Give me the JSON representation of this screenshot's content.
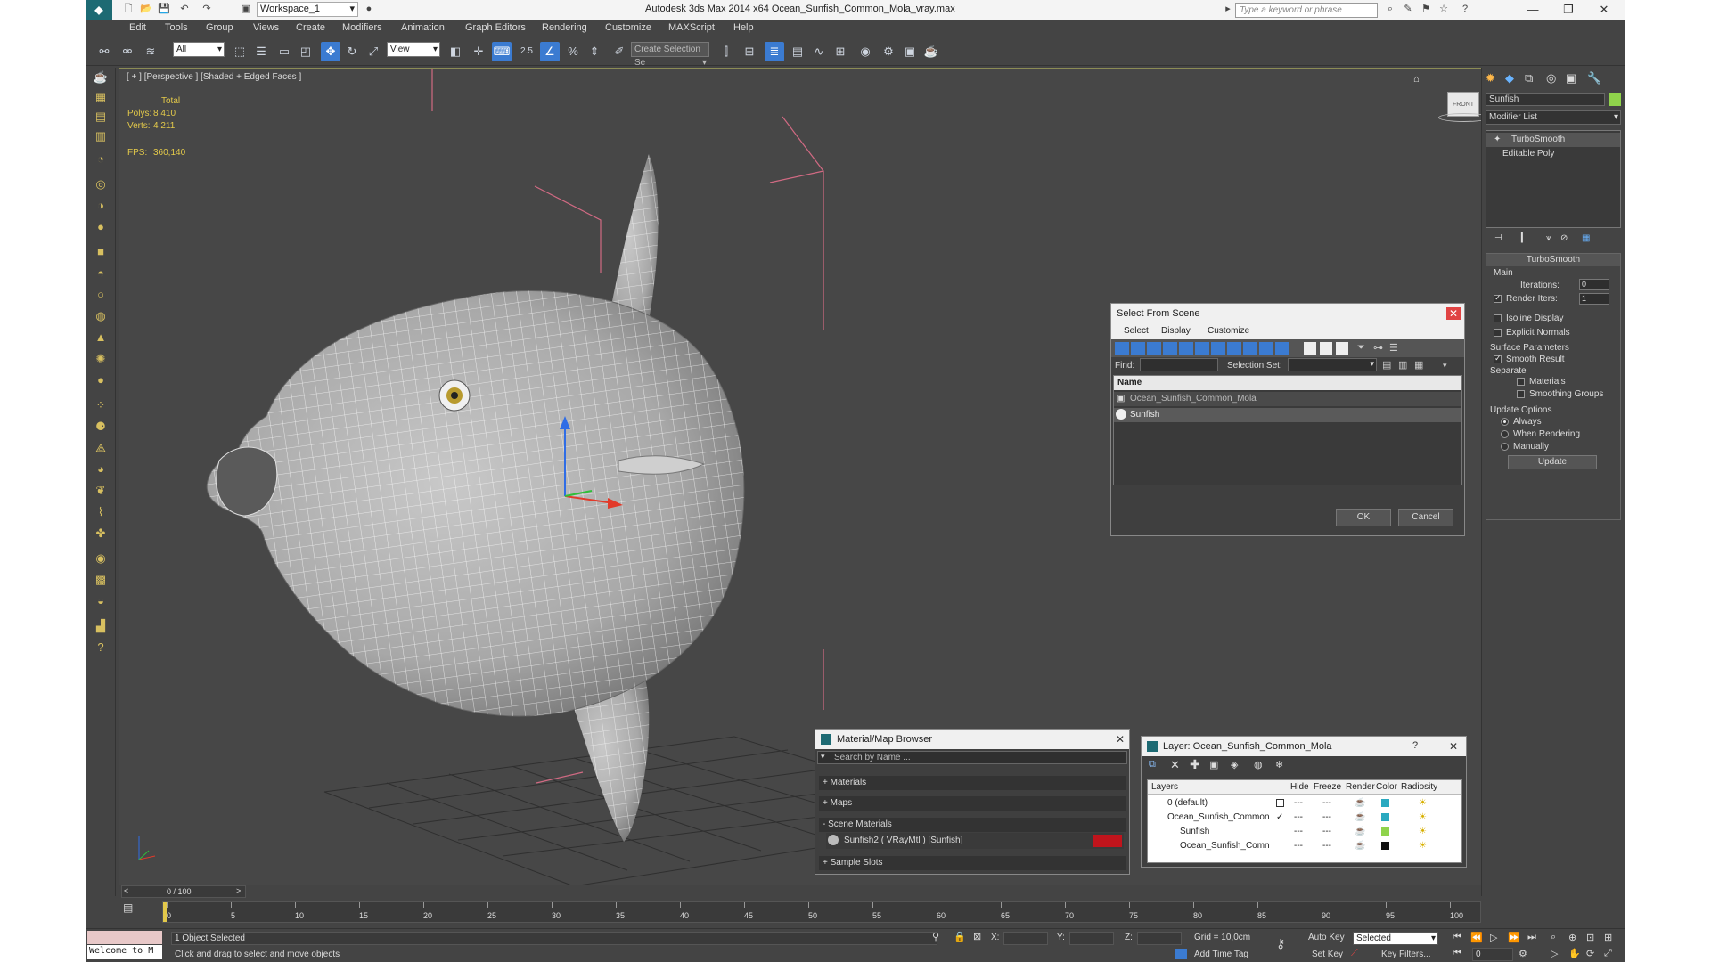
{
  "app": {
    "title": "Autodesk 3ds Max  2014 x64     Ocean_Sunfish_Common_Mola_vray.max",
    "workspace": "Workspace_1",
    "search_placeholder": "Type a keyword or phrase",
    "window_buttons": [
      "—",
      "❐",
      "✕"
    ]
  },
  "menu": [
    "Edit",
    "Tools",
    "Group",
    "Views",
    "Create",
    "Modifiers",
    "Animation",
    "Graph Editors",
    "Rendering",
    "Customize",
    "MAXScript",
    "Help"
  ],
  "toolbar": {
    "filter": "All",
    "refcoord": "View",
    "selection_set_placeholder": "Create Selection Se",
    "snap_label": "2.5"
  },
  "viewport": {
    "label": "[ + ] [Perspective ] [Shaded + Edged Faces ]",
    "stats_header": "Total",
    "polys_label": "Polys:",
    "polys_value": "8 410",
    "verts_label": "Verts:",
    "verts_value": "4 211",
    "fps_label": "FPS:",
    "fps_value": "360,140",
    "viewcube_label": "FRONT"
  },
  "command_panel": {
    "object_name": "Sunfish",
    "object_color": "#8fd34b",
    "modifier_list": "Modifier List",
    "stack": [
      "TurboSmooth",
      "Editable Poly"
    ],
    "rollout_title": "TurboSmooth",
    "main_group": "Main",
    "iterations_label": "Iterations:",
    "iterations_value": "0",
    "render_iters_label": "Render Iters:",
    "render_iters_value": "1",
    "isoline_display": "Isoline Display",
    "explicit_normals": "Explicit Normals",
    "surface_params": "Surface Parameters",
    "smooth_result": "Smooth Result",
    "separate": "Separate",
    "materials": "Materials",
    "smoothing_groups": "Smoothing Groups",
    "update_options": "Update Options",
    "always": "Always",
    "when_rendering": "When Rendering",
    "manually": "Manually",
    "update_button": "Update"
  },
  "select_from_scene": {
    "title": "Select From Scene",
    "menus": [
      "Select",
      "Display",
      "Customize"
    ],
    "find_label": "Find:",
    "selection_set_label": "Selection Set:",
    "column_name": "Name",
    "items": [
      "Ocean_Sunfish_Common_Mola",
      "Sunfish"
    ],
    "ok": "OK",
    "cancel": "Cancel"
  },
  "material_browser": {
    "title": "Material/Map Browser",
    "search_placeholder": "Search by Name ...",
    "groups": [
      "+ Materials",
      "+ Maps",
      "- Scene Materials",
      "+ Sample Slots"
    ],
    "material_item": "Sunfish2  ( VRayMtl )  [Sunfish]",
    "swatch_color": "#c0141c"
  },
  "layer_dialog": {
    "title": "Layer: Ocean_Sunfish_Common_Mola",
    "help": "?",
    "columns": [
      "Layers",
      "Hide",
      "Freeze",
      "Render",
      "Color",
      "Radiosity"
    ],
    "rows": [
      {
        "name": "0 (default)",
        "color": "#2aa9c0"
      },
      {
        "name": "Ocean_Sunfish_Common",
        "color": "#2aa9c0"
      },
      {
        "name": "Sunfish",
        "color": "#8fd34b"
      },
      {
        "name": "Ocean_Sunfish_Comn",
        "color": "#111111"
      }
    ]
  },
  "timeline": {
    "frame": "0 / 100",
    "ticks": [
      "0",
      "5",
      "10",
      "15",
      "20",
      "25",
      "30",
      "35",
      "40",
      "45",
      "50",
      "55",
      "60",
      "65",
      "70",
      "75",
      "80",
      "85",
      "90",
      "95",
      "100"
    ]
  },
  "status": {
    "selected": "1 Object Selected",
    "prompt": "Click and drag to select and move objects",
    "welcome": "Welcome to M",
    "x_label": "X:",
    "y_label": "Y:",
    "z_label": "Z:",
    "grid": "Grid = 10,0cm",
    "add_time_tag": "Add Time Tag",
    "auto_key": "Auto Key",
    "set_key": "Set Key",
    "selected_dd": "Selected",
    "key_filters": "Key Filters...",
    "frame_field": "0"
  }
}
